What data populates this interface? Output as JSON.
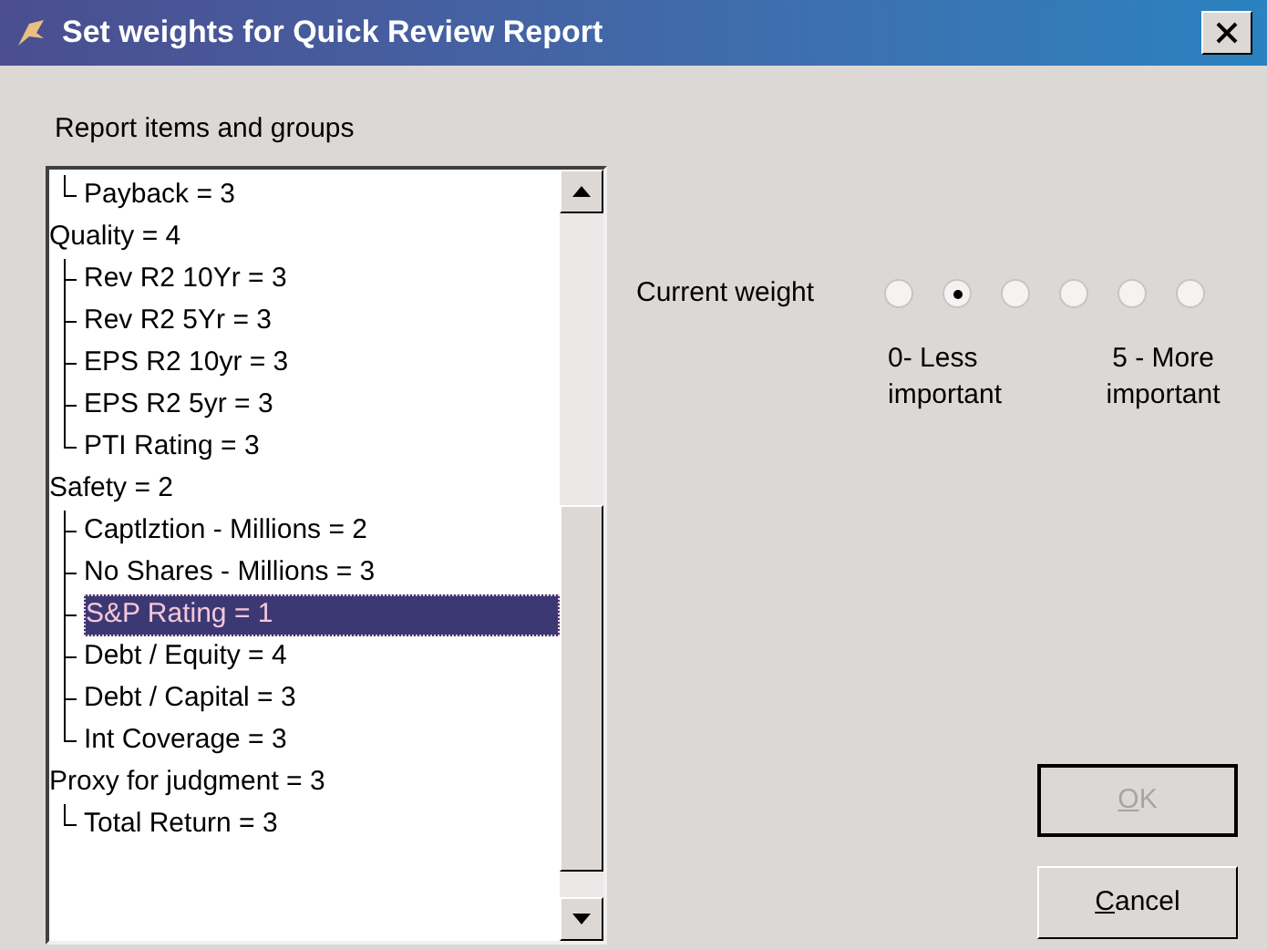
{
  "window": {
    "title": "Set weights for Quick Review Report"
  },
  "tree": {
    "label": "Report items and groups",
    "items": [
      {
        "children": [
          {
            "label": "Payback = 3",
            "selected": false
          }
        ]
      },
      {
        "label": "Quality = 4",
        "selected": false,
        "children": [
          {
            "label": "Rev R2 10Yr = 3",
            "selected": false
          },
          {
            "label": "Rev R2 5Yr = 3",
            "selected": false
          },
          {
            "label": "EPS R2 10yr = 3",
            "selected": false
          },
          {
            "label": "EPS R2 5yr = 3",
            "selected": false
          },
          {
            "label": "PTI Rating = 3",
            "selected": false
          }
        ]
      },
      {
        "label": "Safety = 2",
        "selected": false,
        "children": [
          {
            "label": "Captlztion - Millions = 2",
            "selected": false
          },
          {
            "label": "No Shares - Millions = 3",
            "selected": false
          },
          {
            "label": "S&P Rating = 1",
            "selected": true
          },
          {
            "label": "Debt / Equity = 4",
            "selected": false
          },
          {
            "label": "Debt / Capital = 3",
            "selected": false
          },
          {
            "label": "Int Coverage = 3",
            "selected": false
          }
        ]
      },
      {
        "label": "Proxy for judgment = 3",
        "selected": false,
        "children": [
          {
            "label": "Total Return = 3",
            "selected": false
          }
        ]
      }
    ]
  },
  "weight": {
    "label": "Current weight",
    "options": [
      {
        "selected": false
      },
      {
        "selected": true
      },
      {
        "selected": false
      },
      {
        "selected": false
      },
      {
        "selected": false
      },
      {
        "selected": false
      }
    ],
    "low_label": "0- Less important",
    "high_label": "5 - More important"
  },
  "buttons": [
    {
      "label": "OK",
      "disabled": true
    },
    {
      "label": "Cancel",
      "disabled": false
    }
  ]
}
